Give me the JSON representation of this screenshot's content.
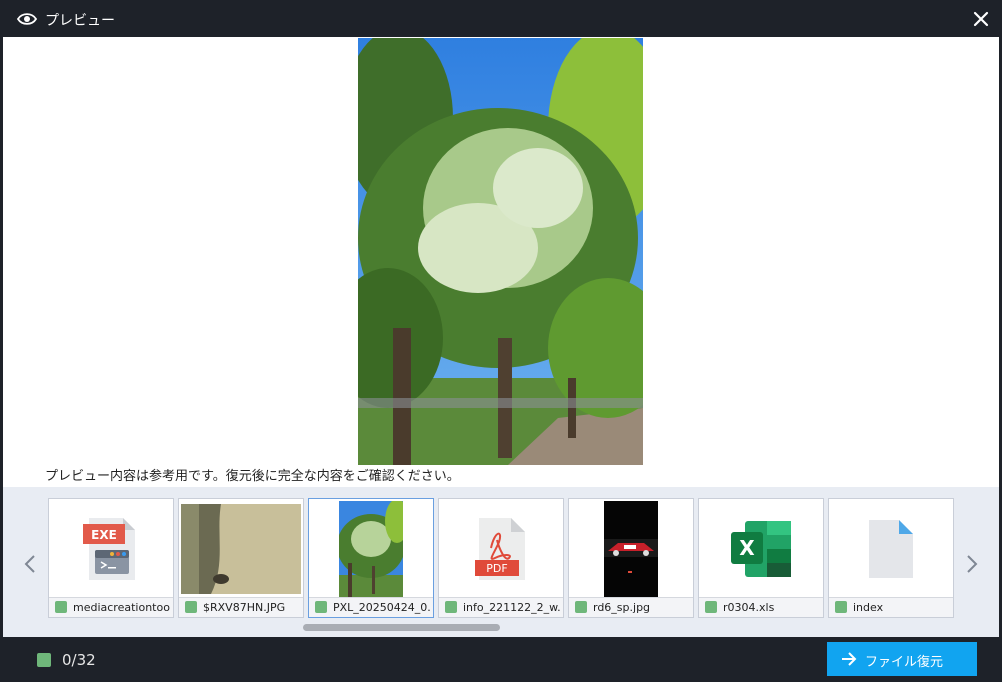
{
  "window": {
    "title": "プレビュー"
  },
  "preview": {
    "notice": "プレビュー内容は参考用です。復元後に完全な内容をご確認ください。"
  },
  "thumbnails": [
    {
      "name": "mediacreationtool...",
      "icon": "exe-file-icon",
      "badge": "EXE"
    },
    {
      "name": "$RXV87HN.JPG",
      "icon": "photo-thumbnail"
    },
    {
      "name": "PXL_20250424_0...",
      "icon": "photo-thumbnail",
      "selected": true
    },
    {
      "name": "info_221122_2_w...",
      "icon": "pdf-file-icon",
      "badge": "PDF"
    },
    {
      "name": "rd6_sp.jpg",
      "icon": "photo-thumbnail"
    },
    {
      "name": "r0304.xls",
      "icon": "excel-file-icon",
      "badge": "X"
    },
    {
      "name": "index",
      "icon": "generic-file-icon"
    }
  ],
  "footer": {
    "count": "0/32",
    "restore_label": "ファイル復元"
  },
  "colors": {
    "accent": "#11a4f0",
    "checkbox": "#6fb77a",
    "background": "#1e2229"
  }
}
